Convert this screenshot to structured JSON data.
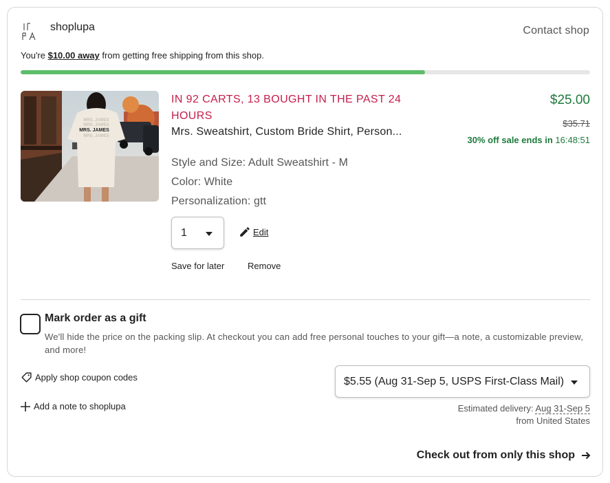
{
  "shop": {
    "name": "shoplupa",
    "contact_label": "Contact shop"
  },
  "shipping_banner": {
    "prefix": "You're ",
    "amount": "$10.00 away",
    "suffix": " from getting free shipping from this shop.",
    "progress_percent": 71
  },
  "item": {
    "demand_text": "IN 92 CARTS, 13 BOUGHT IN THE PAST 24 HOURS",
    "title": "Mrs. Sweatshirt, Custom Bride Shirt, Person...",
    "variations": [
      "Style and Size: Adult Sweatshirt - M",
      "Color: White",
      "Personalization: gtt"
    ],
    "quantity": "1",
    "edit_label": "Edit",
    "save_for_later_label": "Save for later",
    "remove_label": "Remove",
    "price": "$25.00",
    "original_price": "$35.71",
    "sale_prefix": "30% off sale ends in ",
    "sale_timer": "16:48:51",
    "image_text": "MRS. JAMES"
  },
  "gift": {
    "title": "Mark order as a gift",
    "description": "We'll hide the price on the packing slip. At checkout you can add free personal touches to your gift—a note, a customizable preview, and more!"
  },
  "actions": {
    "coupon_label": "Apply shop coupon codes",
    "add_note_label": "Add a note to shoplupa"
  },
  "shipping": {
    "selected_option": "$5.55 (Aug 31-Sep 5, USPS First-Class Mail)",
    "estimated_prefix": "Estimated delivery: ",
    "estimated_dates": "Aug 31-Sep 5",
    "ships_from": "from United States"
  },
  "checkout": {
    "label": "Check out from only this shop"
  },
  "colors": {
    "accent_green": "#1f7a3c",
    "progress_green": "#5cbd6a",
    "demand_red": "#c41e4a"
  }
}
